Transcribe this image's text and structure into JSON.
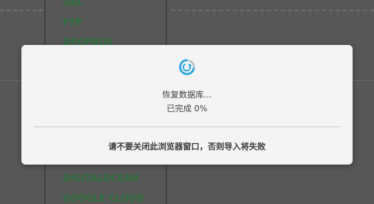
{
  "background": {
    "menu_items": [
      "URL",
      "FTP",
      "DROPBOX",
      "DIGITALOCEAN",
      "GOOGLE CLOUD"
    ],
    "menu_color": "#2a6f3a"
  },
  "dialog": {
    "status_text": "恢复数据库...",
    "progress_prefix": "已完成",
    "progress_value": "0%",
    "progress_fraction": 0,
    "warning_text": "请不要关闭此浏览器窗口，否则导入将失败",
    "spinner_icon": "refresh-spinner-icon",
    "spinner_color": "#2aa3df"
  }
}
